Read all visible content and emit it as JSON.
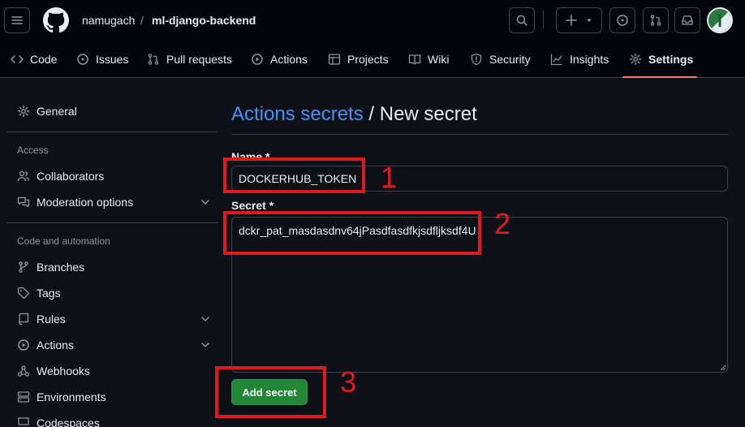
{
  "header": {
    "owner": "namugach",
    "separator": "/",
    "repo": "ml-django-backend"
  },
  "repo_nav": {
    "tabs": [
      {
        "label": "Code",
        "icon": "code-icon"
      },
      {
        "label": "Issues",
        "icon": "issue-icon"
      },
      {
        "label": "Pull requests",
        "icon": "pull-request-icon"
      },
      {
        "label": "Actions",
        "icon": "play-icon"
      },
      {
        "label": "Projects",
        "icon": "table-icon"
      },
      {
        "label": "Wiki",
        "icon": "book-icon"
      },
      {
        "label": "Security",
        "icon": "shield-icon"
      },
      {
        "label": "Insights",
        "icon": "graph-icon"
      },
      {
        "label": "Settings",
        "icon": "gear-icon",
        "active": true
      }
    ]
  },
  "sidebar": {
    "general": "General",
    "access_heading": "Access",
    "collaborators": "Collaborators",
    "moderation": "Moderation options",
    "code_heading": "Code and automation",
    "branches": "Branches",
    "tags": "Tags",
    "rules": "Rules",
    "actions": "Actions",
    "webhooks": "Webhooks",
    "environments": "Environments",
    "codespaces": "Codespaces"
  },
  "main": {
    "title_link": "Actions secrets",
    "title_sep": "/",
    "title_rest": "New secret",
    "name_label": "Name *",
    "name_value": "DOCKERHUB_TOKEN",
    "secret_label": "Secret *",
    "secret_value": "dckr_pat_masdasdnv64jPasdfasdfkjsdfljksdf4U",
    "submit_label": "Add secret"
  },
  "annotations": {
    "one": "1",
    "two": "2",
    "three": "3"
  },
  "colors": {
    "background": "#0d1117",
    "link": "#4493f8",
    "primary_button": "#238636",
    "active_tab_underline": "#f78166",
    "annotation": "#e0191f"
  }
}
